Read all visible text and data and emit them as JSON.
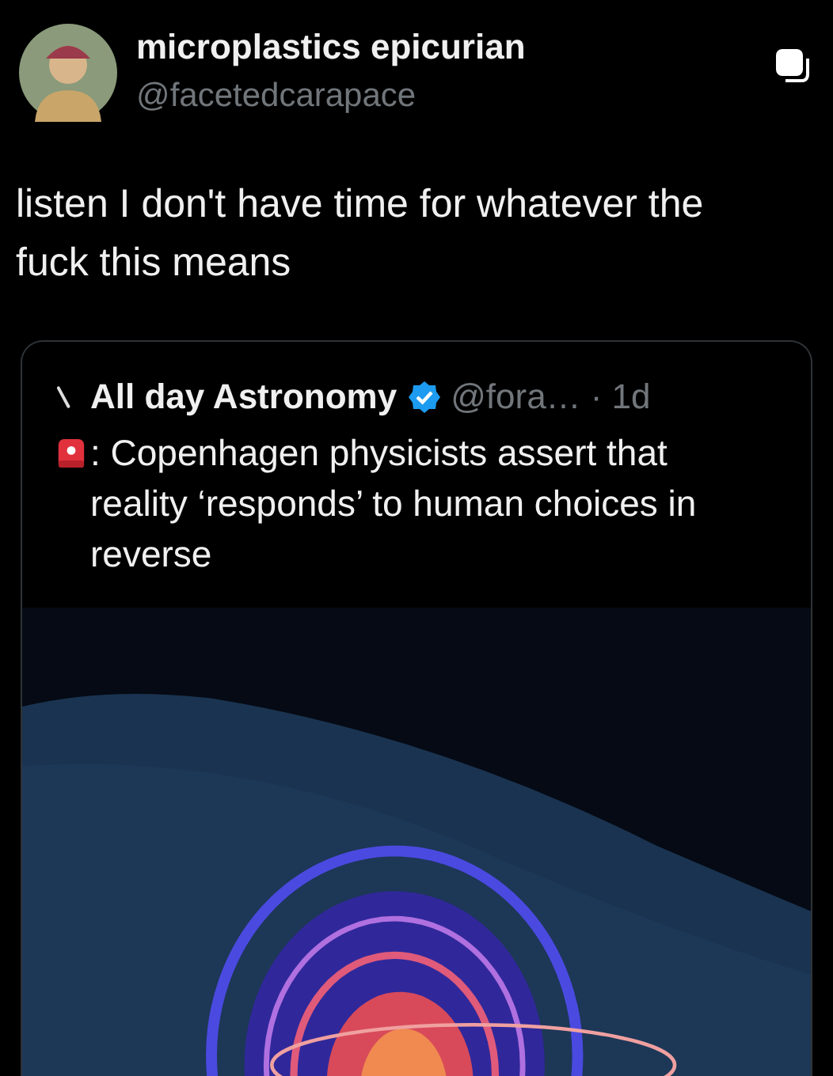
{
  "author": {
    "name": "microplastics epicurian",
    "handle": "@facetedcarapace"
  },
  "post": {
    "text": "listen I don't have time for whatever the fuck this means"
  },
  "quoted_post": {
    "name": "All day Astronomy",
    "verified": true,
    "handle": "@fora…",
    "time": "· 1d",
    "text": ": Copenhagen physicists assert that reality ‘responds’ to human choices in reverse"
  }
}
